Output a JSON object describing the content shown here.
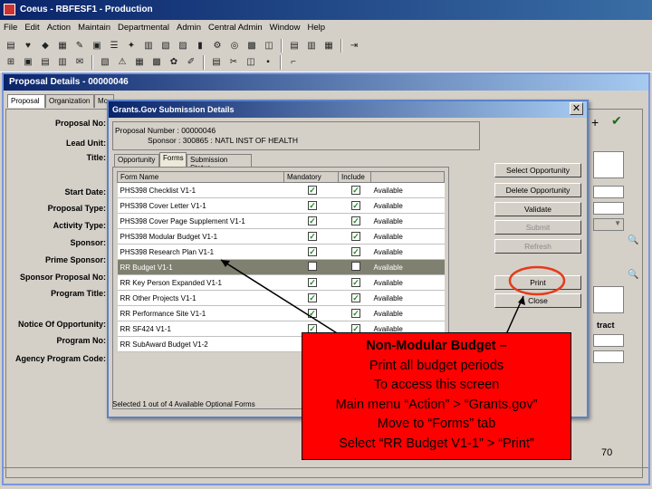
{
  "app": {
    "title": "Coeus - RBFESF1 - Production"
  },
  "menu": [
    "File",
    "Edit",
    "Action",
    "Maintain",
    "Departmental",
    "Admin",
    "Central Admin",
    "Window",
    "Help"
  ],
  "proposal_window": {
    "title": "Proposal Details - 00000046",
    "tabs": [
      "Proposal",
      "Organization",
      "Mo"
    ],
    "labels": {
      "proposal_no": "Proposal No:",
      "lead_unit": "Lead Unit:",
      "title": "Title:",
      "start_date": "Start Date:",
      "proposal_type": "Proposal Type:",
      "activity_type": "Activity Type:",
      "sponsor": "Sponsor:",
      "prime_sponsor": "Prime Sponsor:",
      "sponsor_proposal_no": "Sponsor Proposal No:",
      "program_title": "Program Title:",
      "notice_of_opportunity": "Notice Of Opportunity:",
      "program_no": "Program No:",
      "agency_program_code": "Agency Program Code:"
    },
    "tract_fragment": "tract"
  },
  "dialog": {
    "title": "Grants.Gov Submission Details",
    "proposal_number_label": "Proposal Number :",
    "proposal_number": "00000046",
    "sponsor_label": "Sponsor :",
    "sponsor_value": "300865 : NATL INST OF HEALTH",
    "tabs": [
      "Opportunity",
      "Forms",
      "Submission Status"
    ],
    "columns": [
      "Form Name",
      "Mandatory",
      "Include",
      ""
    ],
    "rows": [
      {
        "name": "PHS398 Checklist V1-1",
        "mandatory": true,
        "include": true,
        "status": "Available"
      },
      {
        "name": "PHS398 Cover Letter V1-1",
        "mandatory": true,
        "include": true,
        "status": "Available"
      },
      {
        "name": "PHS398 Cover Page Supplement V1-1",
        "mandatory": true,
        "include": true,
        "status": "Available"
      },
      {
        "name": "PHS398 Modular Budget V1-1",
        "mandatory": true,
        "include": true,
        "status": "Available"
      },
      {
        "name": "PHS398 Research Plan V1-1",
        "mandatory": true,
        "include": true,
        "status": "Available"
      },
      {
        "name": "RR Budget V1-1",
        "mandatory": false,
        "include": false,
        "status": "Available",
        "selected": true
      },
      {
        "name": "RR Key Person Expanded V1-1",
        "mandatory": true,
        "include": true,
        "status": "Available"
      },
      {
        "name": "RR Other Projects V1-1",
        "mandatory": true,
        "include": true,
        "status": "Available"
      },
      {
        "name": "RR Performance Site V1-1",
        "mandatory": true,
        "include": true,
        "status": "Available"
      },
      {
        "name": "RR SF424 V1-1",
        "mandatory": true,
        "include": true,
        "status": "Available"
      },
      {
        "name": "RR SubAward Budget V1-2",
        "mandatory": false,
        "include": false,
        "status": "Available"
      }
    ],
    "footer": "Selected 1 out of 4 Available Optional Forms",
    "buttons": {
      "select_opportunity": "Select Opportunity",
      "delete_opportunity": "Delete Opportunity",
      "validate": "Validate",
      "submit": "Submit",
      "refresh": "Refresh",
      "print": "Print",
      "close": "Close"
    }
  },
  "callout": {
    "line1": "Non-Modular Budget –",
    "line2": "Print all budget periods",
    "line3": "To access this screen",
    "line4": "Main menu “Action” > “Grants.gov”",
    "line5": "Move to “Forms” tab",
    "line6": "Select “RR Budget V1-1” > “Print”"
  },
  "page_number": "70",
  "colors": {
    "callout_bg": "#ff0000",
    "highlight_circle": "#e53a1a",
    "check": "#1c8c1c"
  }
}
